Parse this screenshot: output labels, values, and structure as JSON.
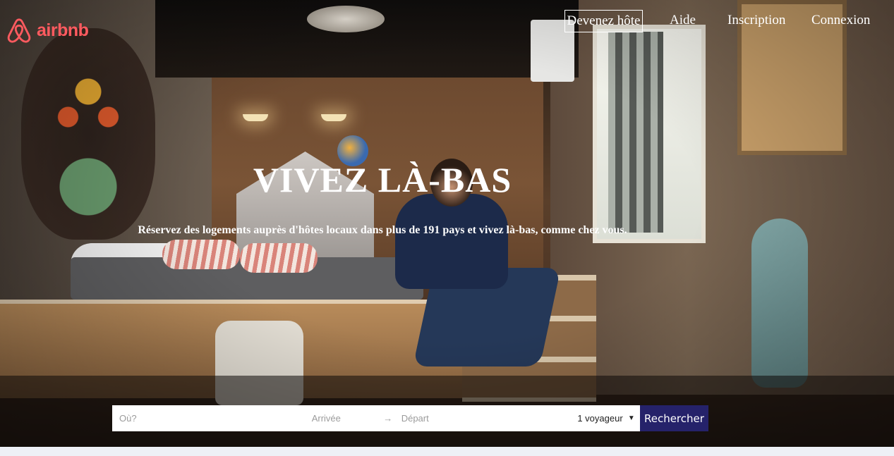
{
  "header": {
    "logo_text": "airbnb",
    "nav": {
      "host": "Devenez hôte",
      "help": "Aide",
      "signup": "Inscription",
      "login": "Connexion"
    }
  },
  "hero": {
    "title": "VIVEZ LÀ-BAS",
    "subtitle": "Réservez des logements auprès d'hôtes locaux dans plus de 191 pays et vivez là-bas, comme chez vous."
  },
  "search": {
    "where_placeholder": "Où?",
    "checkin_placeholder": "Arrivée",
    "arrow": "→",
    "checkout_placeholder": "Départ",
    "guests_value": "1 voyageur",
    "guests_caret": "▼",
    "submit_label": "Rechercher"
  },
  "colors": {
    "brand": "#ff5a5f",
    "search_button": "#25226a"
  }
}
